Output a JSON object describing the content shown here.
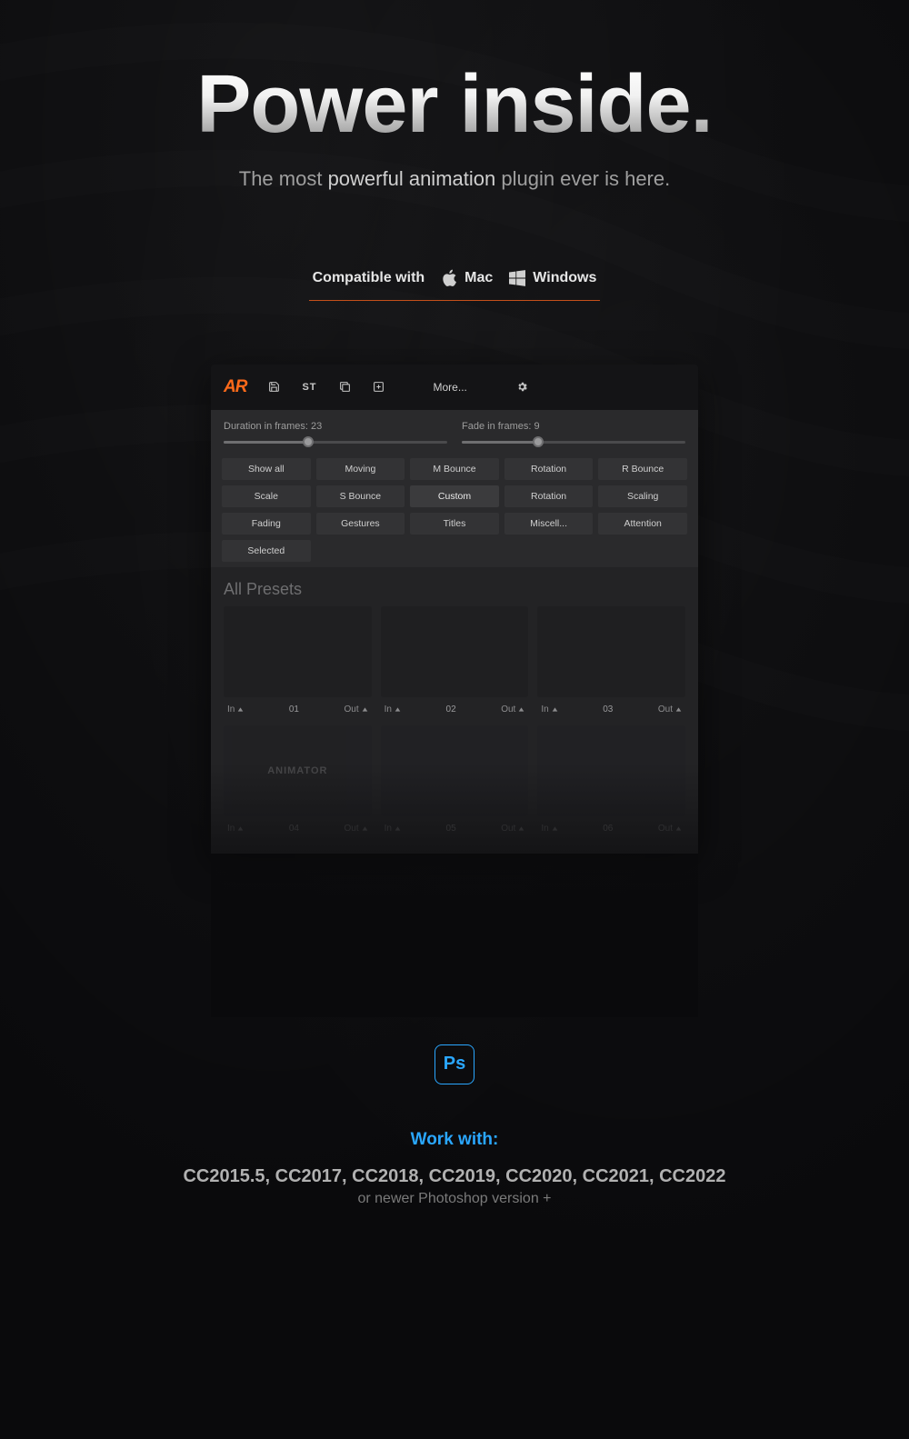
{
  "hero": {
    "title": "Power inside.",
    "subtitle_pre": "The most ",
    "subtitle_em": "powerful animation",
    "subtitle_post": " plugin ever is here."
  },
  "compat": {
    "label": "Compatible with",
    "mac": "Mac",
    "windows": "Windows"
  },
  "toolbar": {
    "logo": "AR",
    "st": "ST",
    "more": "More..."
  },
  "sliders": {
    "duration_label": "Duration in frames: 23",
    "duration_pct": 38,
    "fade_label": "Fade in frames: 9",
    "fade_pct": 34
  },
  "tags": {
    "row1": [
      "Show all",
      "Moving",
      "M Bounce",
      "Rotation",
      "R Bounce"
    ],
    "row2": [
      "Scale",
      "S Bounce",
      "Custom",
      "Rotation",
      "Scaling"
    ],
    "row3": [
      "Fading",
      "Gestures",
      "Titles",
      "Miscell...",
      "Attention"
    ],
    "row4": [
      "Selected"
    ],
    "selected": "Custom"
  },
  "section_title": "All Presets",
  "cards": [
    {
      "num": "01",
      "in": "In",
      "out": "Out",
      "content": ""
    },
    {
      "num": "02",
      "in": "In",
      "out": "Out",
      "content": ""
    },
    {
      "num": "03",
      "in": "In",
      "out": "Out",
      "content": ""
    },
    {
      "num": "04",
      "in": "In",
      "out": "Out",
      "content": "ANIMATOR",
      "dim": true
    },
    {
      "num": "05",
      "in": "In",
      "out": "Out",
      "content": "",
      "dim": true
    },
    {
      "num": "06",
      "in": "In",
      "out": "Out",
      "content": "",
      "dim": true
    }
  ],
  "bottom": {
    "ps": "Ps",
    "work_with": "Work with:",
    "versions": "CC2015.5, CC2017, CC2018, CC2019, CC2020, CC2021, CC2022",
    "versions_sub": "or newer Photoshop version +"
  }
}
